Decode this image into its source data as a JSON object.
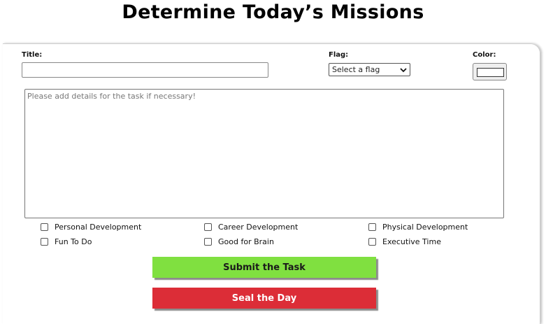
{
  "header": {
    "title": "Determine Today’s Missions"
  },
  "form": {
    "title_label": "Title:",
    "title_value": "",
    "flag_label": "Flag:",
    "flag_selected": "Select a flag",
    "color_label": "Color:",
    "color_value": "#ffffff",
    "details_placeholder": "Please add details for the task if necessary!"
  },
  "categories": [
    {
      "label": "Personal Development",
      "checked": false
    },
    {
      "label": "Career Development",
      "checked": false
    },
    {
      "label": "Physical Development",
      "checked": false
    },
    {
      "label": "Fun To Do",
      "checked": false
    },
    {
      "label": "Good for Brain",
      "checked": false
    },
    {
      "label": "Executive Time",
      "checked": false
    }
  ],
  "buttons": {
    "submit_label": "Submit the Task",
    "seal_label": "Seal the Day"
  },
  "colors": {
    "submit": "#80e040",
    "seal": "#dc2d37"
  }
}
